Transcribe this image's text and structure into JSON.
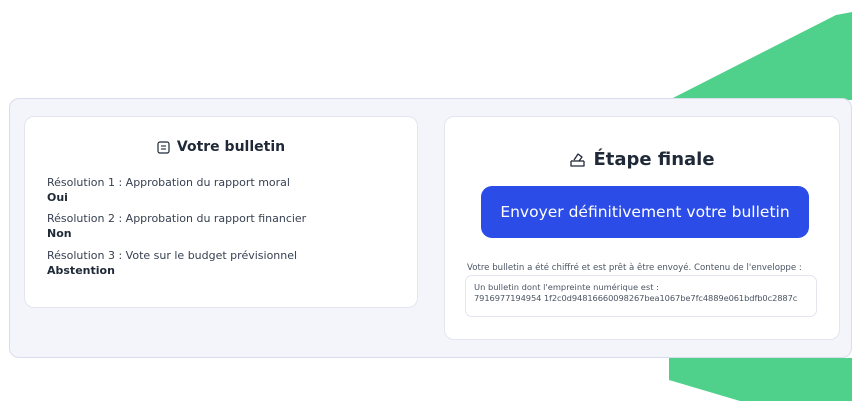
{
  "ballot_card": {
    "title": "Votre bulletin",
    "icon": "ballot-list-icon",
    "resolutions": [
      {
        "question": "Résolution 1 : Approbation du rapport moral",
        "answer": "Oui"
      },
      {
        "question": "Résolution 2 : Approbation du rapport financier",
        "answer": "Non"
      },
      {
        "question": "Résolution 3 : Vote sur le budget prévisionnel",
        "answer": "Abstention"
      }
    ]
  },
  "final_step": {
    "title": "Étape finale",
    "icon": "ballot-box-icon",
    "send_button_label": "Envoyer définitivement votre bulletin",
    "status_text": "Votre bulletin a été chiffré et est prêt à être envoyé. Contenu de l'enveloppe :",
    "envelope_label": "Un bulletin dont l'empreinte numérique est :",
    "fingerprint": "7916977194954 1f2c0d94816660098267bea1067be7fc4889e061bdfb0c2887c"
  },
  "colors": {
    "accent": "#2b4ce6",
    "decoration": "#4fd18b",
    "frame_background": "#f4f5fb"
  }
}
